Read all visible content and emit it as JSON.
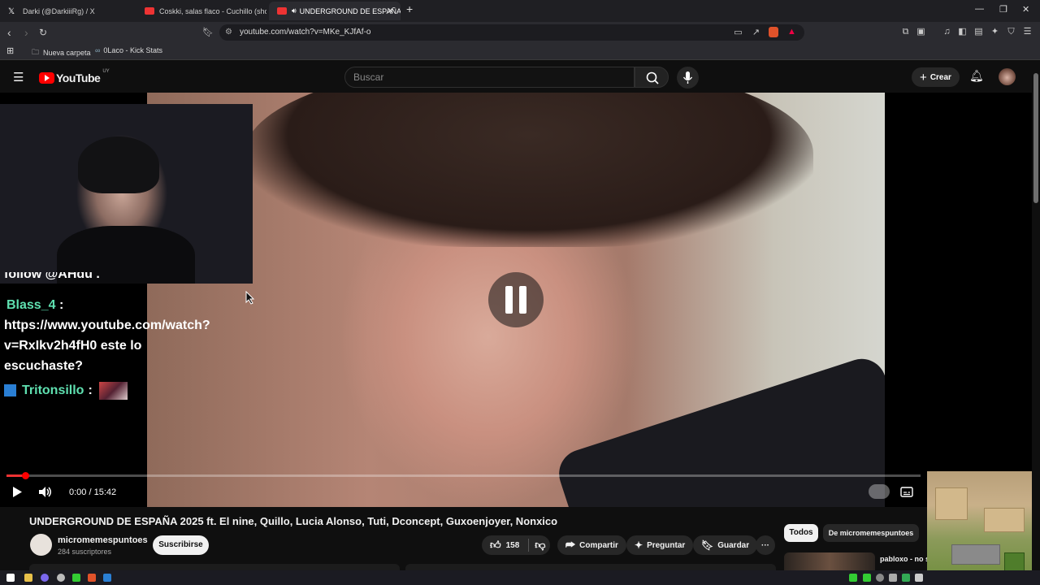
{
  "browser": {
    "tabs": [
      {
        "label": "Darki (@DarkiiiRg) / X",
        "favicon": "x-icon"
      },
      {
        "label": "Coskki, salas flaco - Cuchillo (shot. @",
        "favicon": "youtube-icon"
      },
      {
        "label": "UNDERGROUND DE ESPAÑA",
        "favicon": "youtube-icon"
      }
    ],
    "new_tab": "+",
    "url": "youtube.com/watch?v=MKe_KJfAf-o",
    "bookmarks": [
      {
        "label": "Nueva carpeta",
        "icon": "folder-icon"
      },
      {
        "label": "0Laco - Kick Stats",
        "icon": "link-icon"
      }
    ]
  },
  "youtube": {
    "logo_text": "YouTube",
    "region": "UY",
    "search_placeholder": "Buscar",
    "create_label": "Crear"
  },
  "chat": {
    "partial_line": "follow @AHdu .",
    "messages": [
      {
        "user": "Blass_4",
        "sep": ":",
        "text_lines": [
          "https://www.youtube.com/watch?",
          "v=RxIkv2h4fH0 este lo",
          "escuchaste?"
        ]
      },
      {
        "user": "Tritonsillo",
        "sep": ":",
        "text_lines": []
      }
    ]
  },
  "player": {
    "time": "0:00 / 15:42",
    "progress": 0.02
  },
  "video": {
    "title": "UNDERGROUND DE ESPAÑA 2025 ft. El nine, Quillo, Lucia Alonso, Tuti, Dconcept, Guxoenjoyer, Nonxico",
    "channel": "micromemespuntoes",
    "subscribers": "284 suscriptores",
    "subscribe_label": "Suscribirse",
    "likes": "158",
    "share_label": "Compartir",
    "ask_label": "Preguntar",
    "save_label": "Guardar",
    "more_label": "···"
  },
  "sidebar": {
    "filter_all": "Todos",
    "filter_channel": "De micromemespuntoes",
    "suggestion_title": "pabloxo - no s clones (prod"
  },
  "colors": {
    "accent": "#ff0000",
    "background": "#0f0f0f",
    "chat_user": "#5fe0b0"
  }
}
